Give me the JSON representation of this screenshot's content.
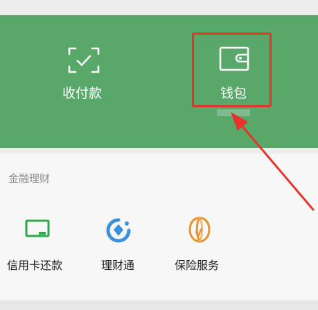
{
  "top_panel": {
    "items": [
      {
        "label": "收付款",
        "icon": "scan-check-icon"
      },
      {
        "label": "钱包",
        "icon": "wallet-icon"
      }
    ],
    "highlight_color": "#e8322c",
    "panel_color": "#58a86a"
  },
  "finance": {
    "title": "金融理财",
    "items": [
      {
        "label": "信用卡还款",
        "icon": "credit-card-icon",
        "color": "#2aa84b"
      },
      {
        "label": "理财通",
        "icon": "licaitong-icon",
        "color": "#3b8fdc"
      },
      {
        "label": "保险服务",
        "icon": "insurance-umbrella-icon",
        "color": "#e8922c"
      }
    ]
  },
  "annotation": {
    "arrow_color": "#e8322c"
  }
}
